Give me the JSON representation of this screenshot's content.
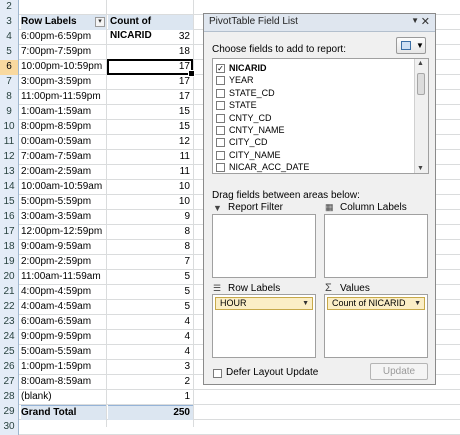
{
  "sheet": {
    "row_numbers": [
      "2",
      "3",
      "4",
      "5",
      "6",
      "7",
      "8",
      "9",
      "10",
      "11",
      "12",
      "13",
      "14",
      "15",
      "16",
      "17",
      "18",
      "19",
      "20",
      "21",
      "22",
      "23",
      "24",
      "25",
      "26",
      "27",
      "28",
      "29",
      "30"
    ],
    "header": {
      "col_a": "Row Labels",
      "col_b": "Count of NICARID"
    },
    "rows": [
      {
        "label": "6:00pm-6:59pm",
        "count": "32"
      },
      {
        "label": "7:00pm-7:59pm",
        "count": "18"
      },
      {
        "label": "10:00pm-10:59pm",
        "count": "17"
      },
      {
        "label": "3:00pm-3:59pm",
        "count": "17"
      },
      {
        "label": "11:00pm-11:59pm",
        "count": "17"
      },
      {
        "label": "1:00am-1:59am",
        "count": "15"
      },
      {
        "label": "8:00pm-8:59pm",
        "count": "15"
      },
      {
        "label": "0:00am-0:59am",
        "count": "12"
      },
      {
        "label": "7:00am-7:59am",
        "count": "11"
      },
      {
        "label": "2:00am-2:59am",
        "count": "11"
      },
      {
        "label": "10:00am-10:59am",
        "count": "10"
      },
      {
        "label": "5:00pm-5:59pm",
        "count": "10"
      },
      {
        "label": "3:00am-3:59am",
        "count": "9"
      },
      {
        "label": "12:00pm-12:59pm",
        "count": "8"
      },
      {
        "label": "9:00am-9:59am",
        "count": "8"
      },
      {
        "label": "2:00pm-2:59pm",
        "count": "7"
      },
      {
        "label": "11:00am-11:59am",
        "count": "5"
      },
      {
        "label": "4:00pm-4:59pm",
        "count": "5"
      },
      {
        "label": "4:00am-4:59am",
        "count": "5"
      },
      {
        "label": "6:00am-6:59am",
        "count": "4"
      },
      {
        "label": "9:00pm-9:59pm",
        "count": "4"
      },
      {
        "label": "5:00am-5:59am",
        "count": "4"
      },
      {
        "label": "1:00pm-1:59pm",
        "count": "3"
      },
      {
        "label": "8:00am-8:59am",
        "count": "2"
      },
      {
        "label": "(blank)",
        "count": "1"
      }
    ],
    "total": {
      "label": "Grand Total",
      "count": "250"
    }
  },
  "field_list": {
    "title": "PivotTable Field List",
    "menu_glyph": "▼",
    "close_glyph": "✕",
    "choose_label": "Choose fields to add to report:",
    "fields": [
      {
        "name": "NICARID",
        "checked": true
      },
      {
        "name": "YEAR",
        "checked": false
      },
      {
        "name": "STATE_CD",
        "checked": false
      },
      {
        "name": "STATE",
        "checked": false
      },
      {
        "name": "CNTY_CD",
        "checked": false
      },
      {
        "name": "CNTY_NAME",
        "checked": false
      },
      {
        "name": "CITY_CD",
        "checked": false
      },
      {
        "name": "CITY_NAME",
        "checked": false
      },
      {
        "name": "NICAR_ACC_DATE",
        "checked": false
      }
    ],
    "check_glyph": "✓",
    "drag_label": "Drag fields between areas below:",
    "areas": {
      "report_filter": "Report Filter",
      "column_labels": "Column Labels",
      "row_labels": "Row Labels",
      "values": "Values"
    },
    "area_icons": {
      "filter": "▼",
      "columns": "▦",
      "rows": "☰",
      "values": "Σ"
    },
    "row_field": "HOUR",
    "value_field": "Count of NICARID",
    "defer_label": "Defer Layout Update",
    "update_label": "Update"
  },
  "colors": {
    "header_fill": "#dce6f1",
    "chip_fill": "#fbeec6",
    "active_row": "#f9d99f"
  }
}
